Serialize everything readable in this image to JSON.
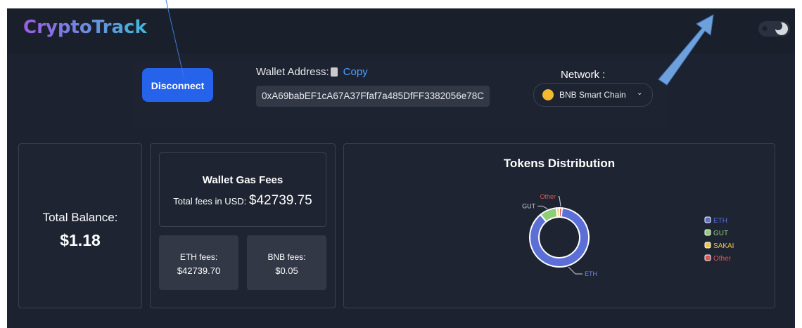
{
  "header": {
    "logo": "CryptoTrack"
  },
  "wallet": {
    "disconnect_label": "Disconnect",
    "address_label": "Wallet Address:",
    "copy_label": "Copy",
    "address": "0xA69babEF1cA67A37Ffaf7a485DfFF3382056e78C"
  },
  "network": {
    "label": "Network :",
    "selected": "BNB Smart Chain"
  },
  "balance": {
    "label": "Total Balance:",
    "value": "$1.18"
  },
  "gas": {
    "title": "Wallet Gas Fees",
    "total_label": "Total fees in USD:",
    "total_value": "$42739.75",
    "eth_label": "ETH fees:",
    "eth_value": "$42739.70",
    "bnb_label": "BNB fees:",
    "bnb_value": "$0.05"
  },
  "distribution": {
    "title": "Tokens Distribution"
  },
  "chart_data": {
    "type": "pie",
    "title": "Tokens Distribution",
    "categories": [
      "ETH",
      "GUT",
      "SAKAI",
      "Other"
    ],
    "values": [
      87.5,
      9.5,
      1.5,
      1.5
    ],
    "colors": [
      "#5b6fd6",
      "#8fce77",
      "#f3c443",
      "#e05555"
    ],
    "legend_position": "right"
  }
}
